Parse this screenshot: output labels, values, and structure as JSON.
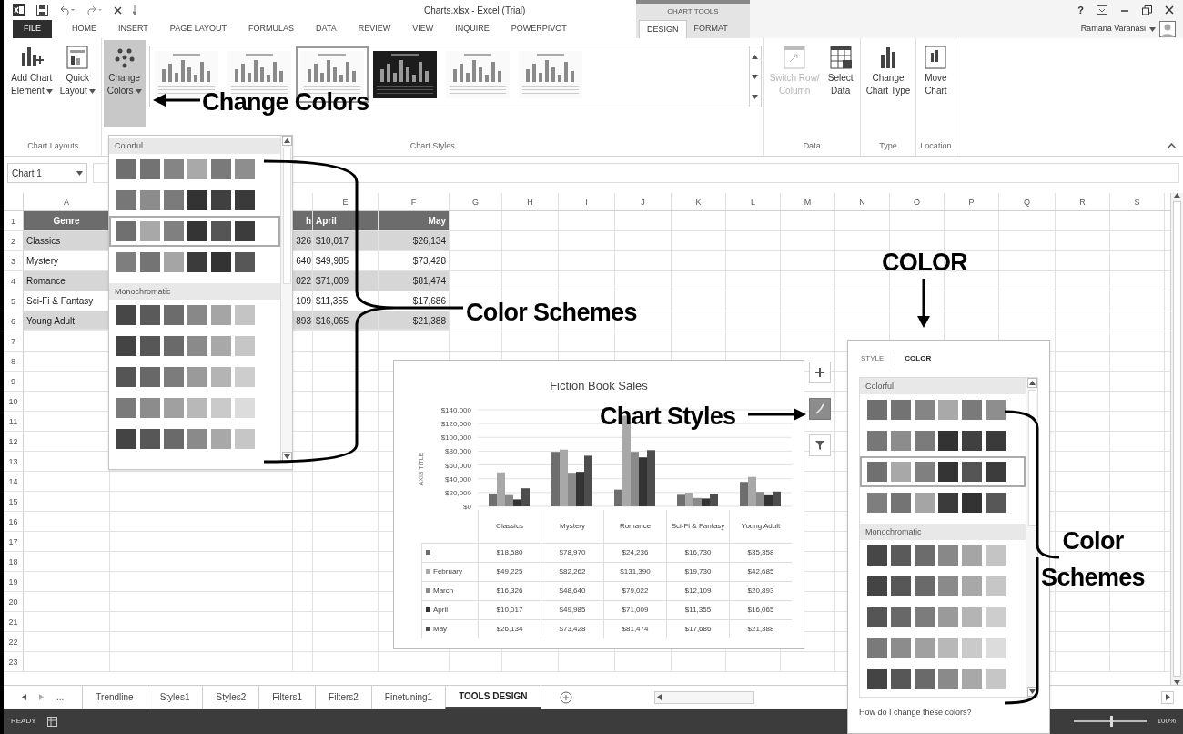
{
  "title_bar": {
    "title": "Charts.xlsx - Excel (Trial)",
    "context_label": "CHART TOOLS",
    "help": "?"
  },
  "tabs": [
    {
      "label": "FILE",
      "kind": "file",
      "selected": false
    },
    {
      "label": "HOME",
      "kind": "normal",
      "selected": false
    },
    {
      "label": "INSERT",
      "kind": "normal",
      "selected": false
    },
    {
      "label": "PAGE LAYOUT",
      "kind": "normal",
      "selected": false
    },
    {
      "label": "FORMULAS",
      "kind": "normal",
      "selected": false
    },
    {
      "label": "DATA",
      "kind": "normal",
      "selected": false
    },
    {
      "label": "REVIEW",
      "kind": "normal",
      "selected": false
    },
    {
      "label": "VIEW",
      "kind": "normal",
      "selected": false
    },
    {
      "label": "INQUIRE",
      "kind": "normal",
      "selected": false
    },
    {
      "label": "POWERPIVOT",
      "kind": "normal",
      "selected": false
    },
    {
      "label": "DESIGN",
      "kind": "context",
      "selected": true
    },
    {
      "label": "FORMAT",
      "kind": "context",
      "selected": false
    }
  ],
  "user": {
    "name": "Ramana Varanasi"
  },
  "ribbon": {
    "groups": [
      {
        "label": "Chart Layouts",
        "items": [
          {
            "kind": "button",
            "lines": [
              "Add Chart",
              "Element"
            ],
            "dropdown": true,
            "disabled": false
          },
          {
            "kind": "button",
            "lines": [
              "Quick",
              "Layout"
            ],
            "dropdown": true,
            "disabled": false
          }
        ]
      },
      {
        "label": "Chart Styles",
        "items": [
          {
            "kind": "button",
            "lines": [
              "Change",
              "Colors"
            ],
            "dropdown": true,
            "disabled": false,
            "open": true
          },
          {
            "kind": "gallery",
            "styles": [
              {
                "kind": "light",
                "selected": false
              },
              {
                "kind": "light",
                "selected": false
              },
              {
                "kind": "light",
                "selected": true
              },
              {
                "kind": "dark",
                "selected": false
              },
              {
                "kind": "light",
                "selected": false
              },
              {
                "kind": "light",
                "selected": false
              }
            ]
          }
        ]
      },
      {
        "label": "Data",
        "items": [
          {
            "kind": "button",
            "lines": [
              "Switch Row/",
              "Column"
            ],
            "dropdown": false,
            "disabled": true
          },
          {
            "kind": "button",
            "lines": [
              "Select",
              "Data"
            ],
            "dropdown": false,
            "disabled": false
          }
        ]
      },
      {
        "label": "Type",
        "items": [
          {
            "kind": "button",
            "lines": [
              "Change",
              "Chart Type"
            ],
            "dropdown": false,
            "disabled": false
          }
        ]
      },
      {
        "label": "Location",
        "items": [
          {
            "kind": "button",
            "lines": [
              "Move",
              "Chart"
            ],
            "dropdown": false,
            "disabled": false
          }
        ]
      }
    ]
  },
  "name_box": {
    "value": "Chart 1"
  },
  "sheet": {
    "columns": [
      "A",
      "E",
      "F",
      "G",
      "H",
      "I",
      "J",
      "K",
      "L",
      "M",
      "N",
      "O",
      "P",
      "Q",
      "R",
      "S"
    ],
    "rows": [
      {
        "number": "1",
        "kind": "header",
        "cells": [
          "Genre",
          "h",
          "April",
          "May"
        ]
      },
      {
        "number": "2",
        "kind": "band",
        "cells": [
          "Classics",
          "326",
          "$10,017",
          "$26,134"
        ]
      },
      {
        "number": "3",
        "kind": "plain",
        "cells": [
          "Mystery",
          "640",
          "$49,985",
          "$73,428"
        ]
      },
      {
        "number": "4",
        "kind": "band",
        "cells": [
          "Romance",
          "022",
          "$71,009",
          "$81,474"
        ]
      },
      {
        "number": "5",
        "kind": "plain",
        "cells": [
          "Sci-Fi & Fantasy",
          "109",
          "$11,355",
          "$17,686"
        ]
      },
      {
        "number": "6",
        "kind": "last",
        "cells": [
          "Young Adult",
          "893",
          "$16,065",
          "$21,388"
        ]
      },
      {
        "number": "7"
      },
      {
        "number": "8"
      },
      {
        "number": "9"
      },
      {
        "number": "10"
      },
      {
        "number": "11"
      },
      {
        "number": "12"
      },
      {
        "number": "13"
      },
      {
        "number": "14"
      },
      {
        "number": "15"
      },
      {
        "number": "16"
      },
      {
        "number": "17"
      },
      {
        "number": "18"
      },
      {
        "number": "19"
      },
      {
        "number": "20"
      },
      {
        "number": "21"
      },
      {
        "number": "22"
      },
      {
        "number": "23"
      }
    ]
  },
  "change_colors_menu": {
    "sections": [
      {
        "title": "Colorful",
        "schemes": [
          {
            "selected": false,
            "swatches": [
              {
                "color": "#6f6f6f"
              },
              {
                "color": "#737373"
              },
              {
                "color": "#858585"
              },
              {
                "color": "#a9a9a9"
              },
              {
                "color": "#7a7a7a"
              },
              {
                "color": "#8e8e8e"
              }
            ]
          },
          {
            "selected": false,
            "swatches": [
              {
                "color": "#777777"
              },
              {
                "color": "#8c8c8c"
              },
              {
                "color": "#7b7b7b"
              },
              {
                "color": "#333333"
              },
              {
                "color": "#404040"
              },
              {
                "color": "#3a3a3a"
              }
            ]
          },
          {
            "selected": true,
            "swatches": [
              {
                "color": "#707070"
              },
              {
                "color": "#a8a8a8"
              },
              {
                "color": "#808080"
              },
              {
                "color": "#343434"
              },
              {
                "color": "#555555"
              },
              {
                "color": "#3c3c3c"
              }
            ]
          },
          {
            "selected": false,
            "swatches": [
              {
                "color": "#7e7e7e"
              },
              {
                "color": "#747474"
              },
              {
                "color": "#a5a5a5"
              },
              {
                "color": "#3b3b3b"
              },
              {
                "color": "#333333"
              },
              {
                "color": "#575757"
              }
            ]
          }
        ]
      },
      {
        "title": "Monochromatic",
        "schemes": [
          {
            "selected": false,
            "swatches": [
              {
                "color": "#474747"
              },
              {
                "color": "#5a5a5a"
              },
              {
                "color": "#6c6c6c"
              },
              {
                "color": "#888888"
              },
              {
                "color": "#a5a5a5"
              },
              {
                "color": "#c4c4c4"
              }
            ]
          },
          {
            "selected": false,
            "swatches": [
              {
                "color": "#444444"
              },
              {
                "color": "#575757"
              },
              {
                "color": "#6a6a6a"
              },
              {
                "color": "#8a8a8a"
              },
              {
                "color": "#a8a8a8"
              },
              {
                "color": "#c6c6c6"
              }
            ]
          },
          {
            "selected": false,
            "swatches": [
              {
                "color": "#555555"
              },
              {
                "color": "#686868"
              },
              {
                "color": "#7c7c7c"
              },
              {
                "color": "#9a9a9a"
              },
              {
                "color": "#b4b4b4"
              },
              {
                "color": "#cdcdcd"
              }
            ]
          },
          {
            "selected": false,
            "swatches": [
              {
                "color": "#7a7a7a"
              },
              {
                "color": "#8c8c8c"
              },
              {
                "color": "#a0a0a0"
              },
              {
                "color": "#b8b8b8"
              },
              {
                "color": "#cacaca"
              },
              {
                "color": "#dcdcdc"
              }
            ]
          },
          {
            "selected": false,
            "swatches": [
              {
                "color": "#444444"
              },
              {
                "color": "#575757"
              },
              {
                "color": "#6a6a6a"
              },
              {
                "color": "#8a8a8a"
              },
              {
                "color": "#a8a8a8"
              },
              {
                "color": "#c6c6c6"
              }
            ]
          }
        ]
      }
    ]
  },
  "chart": {
    "chart_data": {
      "type": "bar",
      "title": "Fiction Book Sales",
      "ylabel": "AXIS TITLE",
      "grid": true,
      "legend": "left",
      "categories": [
        "Classics",
        "Mystery",
        "Romance",
        "Sci-Fi & Fantasy",
        "Young Adult"
      ],
      "series": [
        {
          "color": "#6e6e6e",
          "values": [
            18580,
            78970,
            24236,
            16730,
            35358
          ]
        },
        {
          "name": "February",
          "color": "#a8a8a8",
          "values": [
            49225,
            82262,
            131390,
            19730,
            42685
          ]
        },
        {
          "name": "March",
          "color": "#8a8a8a",
          "values": [
            16326,
            48640,
            79022,
            12109,
            20893
          ]
        },
        {
          "name": "April",
          "color": "#333333",
          "values": [
            10017,
            49985,
            71009,
            11355,
            16065
          ]
        },
        {
          "name": "May",
          "color": "#4d4d4d",
          "values": [
            26134,
            73428,
            81474,
            17686,
            21388
          ]
        }
      ],
      "ylim": [
        0,
        140000
      ],
      "yticks": [
        {
          "value": 0,
          "label": "$0"
        },
        {
          "value": 20000,
          "label": "$20,000"
        },
        {
          "value": 40000,
          "label": "$40,000"
        },
        {
          "value": 60000,
          "label": "$60,000"
        },
        {
          "value": 80000,
          "label": "$80,000"
        },
        {
          "value": 100000,
          "label": "$100,000"
        },
        {
          "value": 120000,
          "label": "$120,000"
        },
        {
          "value": 140000,
          "label": "$140,000"
        }
      ]
    },
    "table_values": [
      [
        "$18,580",
        "$78,970",
        "$24,236",
        "$16,730",
        "$35,358"
      ],
      [
        "$49,225",
        "$82,262",
        "$131,390",
        "$19,730",
        "$42,685"
      ],
      [
        "$16,326",
        "$48,640",
        "$79,022",
        "$12,109",
        "$20,893"
      ],
      [
        "$10,017",
        "$49,985",
        "$71,009",
        "$11,355",
        "$16,065"
      ],
      [
        "$26,134",
        "$73,428",
        "$81,474",
        "$17,686",
        "$21,388"
      ]
    ]
  },
  "chart_buttons": [
    {
      "kind": "add",
      "selected": false
    },
    {
      "kind": "style",
      "selected": true
    },
    {
      "kind": "filter",
      "selected": false
    }
  ],
  "style_panel": {
    "tabs": [
      {
        "label": "STYLE",
        "selected": false
      },
      {
        "label": "COLOR",
        "selected": true
      }
    ],
    "sections": [
      {
        "title": "Colorful",
        "schemes": [
          {
            "selected": false,
            "swatches": [
              {
                "color": "#6f6f6f"
              },
              {
                "color": "#737373"
              },
              {
                "color": "#858585"
              },
              {
                "color": "#a9a9a9"
              },
              {
                "color": "#7a7a7a"
              },
              {
                "color": "#8e8e8e"
              }
            ]
          },
          {
            "selected": false,
            "swatches": [
              {
                "color": "#777777"
              },
              {
                "color": "#8c8c8c"
              },
              {
                "color": "#7b7b7b"
              },
              {
                "color": "#333333"
              },
              {
                "color": "#404040"
              },
              {
                "color": "#3a3a3a"
              }
            ]
          },
          {
            "selected": true,
            "swatches": [
              {
                "color": "#707070"
              },
              {
                "color": "#a8a8a8"
              },
              {
                "color": "#808080"
              },
              {
                "color": "#343434"
              },
              {
                "color": "#555555"
              },
              {
                "color": "#3c3c3c"
              }
            ]
          },
          {
            "selected": false,
            "swatches": [
              {
                "color": "#7e7e7e"
              },
              {
                "color": "#747474"
              },
              {
                "color": "#a5a5a5"
              },
              {
                "color": "#3b3b3b"
              },
              {
                "color": "#333333"
              },
              {
                "color": "#575757"
              }
            ]
          }
        ]
      },
      {
        "title": "Monochromatic",
        "schemes": [
          {
            "selected": false,
            "swatches": [
              {
                "color": "#474747"
              },
              {
                "color": "#5a5a5a"
              },
              {
                "color": "#6c6c6c"
              },
              {
                "color": "#888888"
              },
              {
                "color": "#a5a5a5"
              },
              {
                "color": "#c4c4c4"
              }
            ]
          },
          {
            "selected": false,
            "swatches": [
              {
                "color": "#444444"
              },
              {
                "color": "#575757"
              },
              {
                "color": "#6a6a6a"
              },
              {
                "color": "#8a8a8a"
              },
              {
                "color": "#a8a8a8"
              },
              {
                "color": "#c6c6c6"
              }
            ]
          },
          {
            "selected": false,
            "swatches": [
              {
                "color": "#555555"
              },
              {
                "color": "#686868"
              },
              {
                "color": "#7c7c7c"
              },
              {
                "color": "#9a9a9a"
              },
              {
                "color": "#b4b4b4"
              },
              {
                "color": "#cdcdcd"
              }
            ]
          },
          {
            "selected": false,
            "swatches": [
              {
                "color": "#7a7a7a"
              },
              {
                "color": "#8c8c8c"
              },
              {
                "color": "#a0a0a0"
              },
              {
                "color": "#b8b8b8"
              },
              {
                "color": "#cacaca"
              },
              {
                "color": "#dcdcdc"
              }
            ]
          },
          {
            "selected": false,
            "swatches": [
              {
                "color": "#444444"
              },
              {
                "color": "#575757"
              },
              {
                "color": "#6a6a6a"
              },
              {
                "color": "#8a8a8a"
              },
              {
                "color": "#a8a8a8"
              },
              {
                "color": "#c6c6c6"
              }
            ]
          }
        ]
      }
    ],
    "help_link": "How do I change these colors?"
  },
  "sheet_tabs": {
    "more": "...",
    "tabs": [
      {
        "label": "Trendline",
        "selected": false
      },
      {
        "label": "Styles1",
        "selected": false
      },
      {
        "label": "Styles2",
        "selected": false
      },
      {
        "label": "Filters1",
        "selected": false
      },
      {
        "label": "Filters2",
        "selected": false
      },
      {
        "label": "Finetuning1",
        "selected": false
      },
      {
        "label": "TOOLS DESIGN",
        "selected": true
      }
    ]
  },
  "status_bar": {
    "status": "READY",
    "zoom": "100%",
    "zoom_slider": {
      "level": 0.5
    }
  },
  "annotations": [
    {
      "kind": "change_colors",
      "text": "Change Colors"
    },
    {
      "kind": "schemes_left",
      "text": "Color Schemes"
    },
    {
      "kind": "color",
      "text": "COLOR"
    },
    {
      "kind": "chart_styles",
      "text": "Chart Styles"
    },
    {
      "kind": "schemes_right",
      "text": "Color Schemes"
    }
  ]
}
